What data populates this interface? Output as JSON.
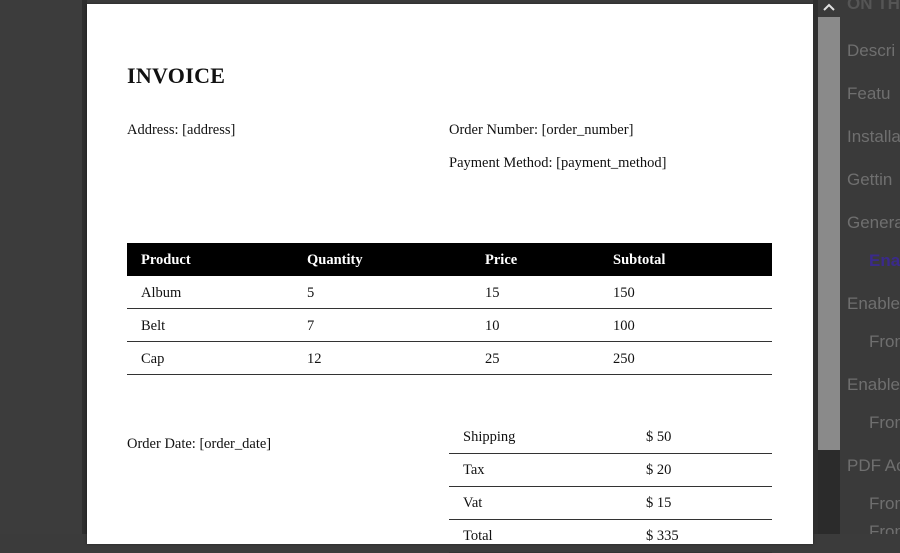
{
  "invoice": {
    "title": "INVOICE",
    "address": "Address: [address]",
    "order_number": "Order Number: [order_number]",
    "payment_method": "Payment Method: [payment_method]",
    "order_date": "Order Date: [order_date]",
    "table": {
      "headers": [
        "Product",
        "Quantity",
        "Price",
        "Subtotal"
      ],
      "rows": [
        [
          "Album",
          "5",
          "15",
          "150"
        ],
        [
          "Belt",
          "7",
          "10",
          "100"
        ],
        [
          "Cap",
          "12",
          "25",
          "250"
        ]
      ]
    },
    "totals": [
      {
        "label": "Shipping",
        "value": "$ 50"
      },
      {
        "label": "Tax",
        "value": "$ 20"
      },
      {
        "label": "Vat",
        "value": "$ 15"
      },
      {
        "label": "Total",
        "value": "$ 335"
      }
    ]
  },
  "sidebar": {
    "items": [
      {
        "label": "ON TH",
        "state": "dim"
      },
      {
        "label": "Descri",
        "state": "normal"
      },
      {
        "label": "Featu",
        "state": "normal"
      },
      {
        "label": "Installa",
        "state": "normal"
      },
      {
        "label": "Gettin",
        "state": "normal"
      },
      {
        "label": "Genera",
        "state": "normal"
      },
      {
        "label": "Ena",
        "state": "active"
      },
      {
        "label": "Enable",
        "state": "normal"
      },
      {
        "label": "From",
        "state": "sub"
      },
      {
        "label": "Enable",
        "state": "normal"
      },
      {
        "label": "From",
        "state": "sub"
      },
      {
        "label": "PDF Ac",
        "state": "normal"
      },
      {
        "label": "From",
        "state": "sub"
      },
      {
        "label": "Fron",
        "state": "sub"
      }
    ]
  },
  "icons": {
    "scroll_up": "chevron-up-icon"
  },
  "colors": {
    "active_link": "#3a2a8c",
    "header_bg": "#000000"
  }
}
